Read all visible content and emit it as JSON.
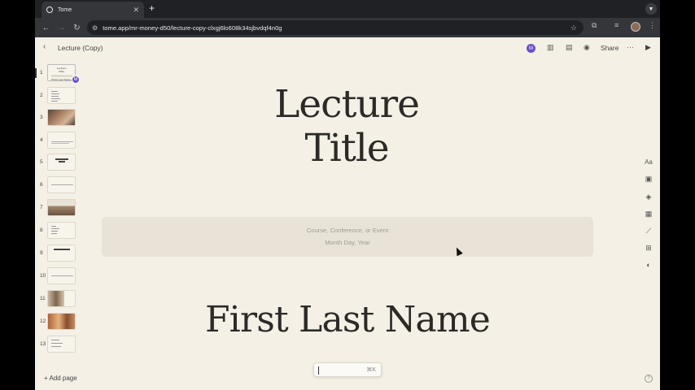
{
  "browser": {
    "tab_title": "Tome",
    "tab_close": "✕",
    "new_tab": "+",
    "url": "tome.app/mr-money-d50/lecture-copy-clxgj6lo608k34sjbvdqf4n0g"
  },
  "header": {
    "back": "‹",
    "doc_title": "Lecture (Copy)",
    "avatar_initial": "M",
    "share_label": "Share",
    "more": "···"
  },
  "sidebar": {
    "pages": [
      {
        "num": "1"
      },
      {
        "num": "2"
      },
      {
        "num": "3"
      },
      {
        "num": "4"
      },
      {
        "num": "5"
      },
      {
        "num": "6"
      },
      {
        "num": "7"
      },
      {
        "num": "8"
      },
      {
        "num": "9"
      },
      {
        "num": "10"
      },
      {
        "num": "11"
      },
      {
        "num": "12"
      },
      {
        "num": "13"
      }
    ],
    "thumb_avatar": "M",
    "add_page_label": "Add page"
  },
  "slide": {
    "title_line1": "Lecture",
    "title_line2": "Title",
    "subtitle_line1": "Course, Conference, or Event",
    "subtitle_line2": "Month Day, Year",
    "author": "First Last Name"
  },
  "toolbar": {
    "text_tool": "Aa"
  },
  "command": {
    "shortcut": "⌘K"
  },
  "help": "?",
  "colors": {
    "canvas": "#f4f0e6",
    "avatar": "#6b4fc4",
    "browser_dark": "#202124"
  }
}
